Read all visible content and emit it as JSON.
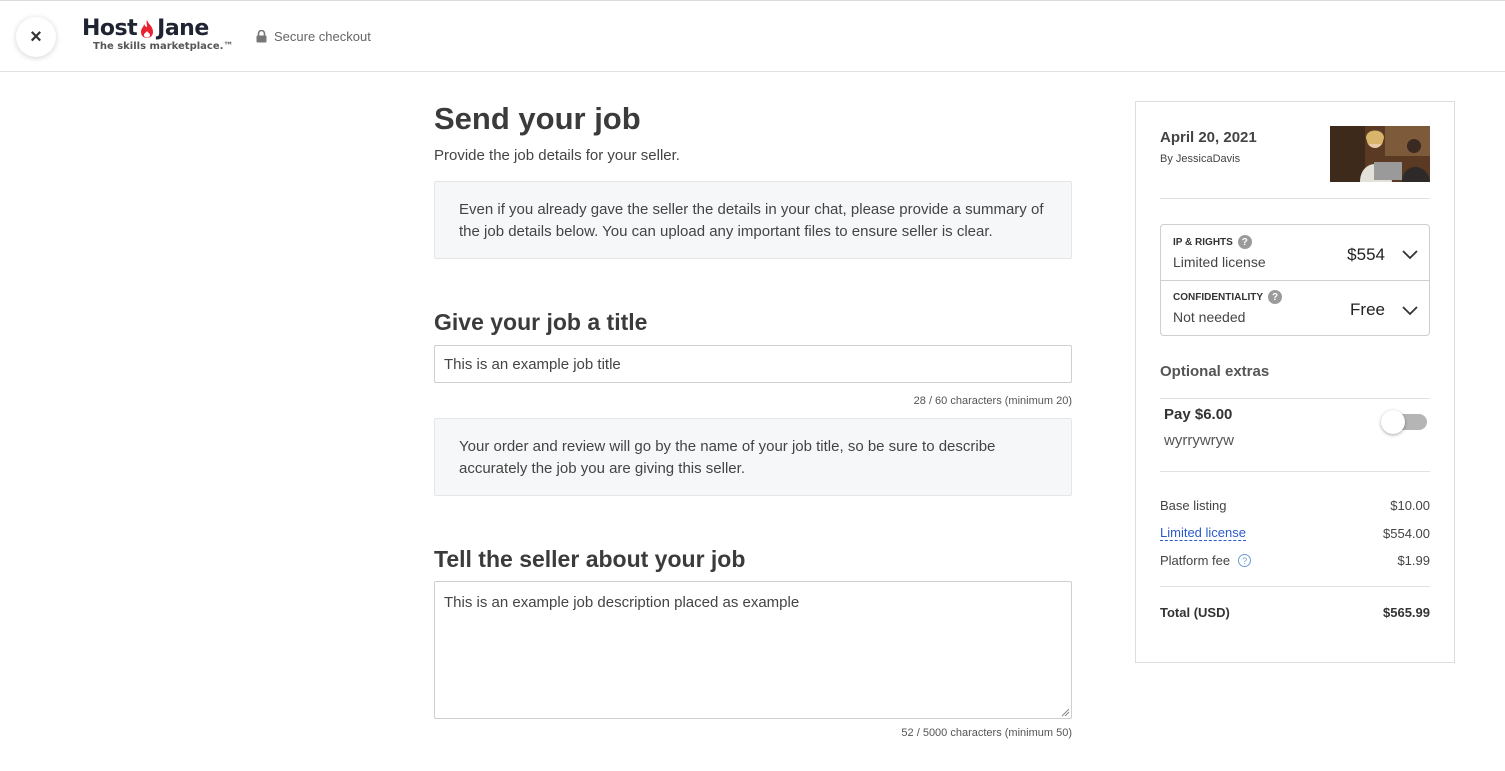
{
  "header": {
    "close_label": "×",
    "logo_left": "Host",
    "logo_right": "Jane",
    "logo_tagline": "The skills marketplace.™",
    "secure_label": "Secure checkout"
  },
  "main": {
    "title": "Send your job",
    "subtitle": "Provide the job details for your seller.",
    "intro_info": "Even if you already gave the seller the details in your chat, please provide a summary of the job details below. You can upload any important files to ensure seller is clear.",
    "title_section": {
      "heading": "Give your job a title",
      "value": "This is an example job title",
      "counter": "28 / 60 characters (minimum 20)",
      "info": "Your order and review will go by the name of your job title, so be sure to describe accurately the job you are giving this seller."
    },
    "description_section": {
      "heading": "Tell the seller about your job",
      "value": "This is an example job description placed as example",
      "counter": "52 / 5000 characters (minimum 50)"
    }
  },
  "sidebar": {
    "date": "April 20, 2021",
    "author": "By JessicaDavis",
    "options": [
      {
        "label": "IP & RIGHTS",
        "value": "Limited license",
        "price": "$554"
      },
      {
        "label": "CONFIDENTIALITY",
        "value": "Not needed",
        "price": "Free"
      }
    ],
    "extras_heading": "Optional extras",
    "extra": {
      "title": "Pay $6.00",
      "description": "wyrrywryw",
      "enabled": false
    },
    "line_items": [
      {
        "label": "Base listing",
        "amount": "$10.00"
      },
      {
        "label": "Limited license",
        "amount": "$554.00"
      },
      {
        "label": "Platform fee",
        "amount": "$1.99"
      }
    ],
    "total": {
      "label": "Total (USD)",
      "amount": "$565.99"
    }
  },
  "colors": {
    "accent_flame": "#e8232f",
    "link": "#2b5bc9"
  }
}
